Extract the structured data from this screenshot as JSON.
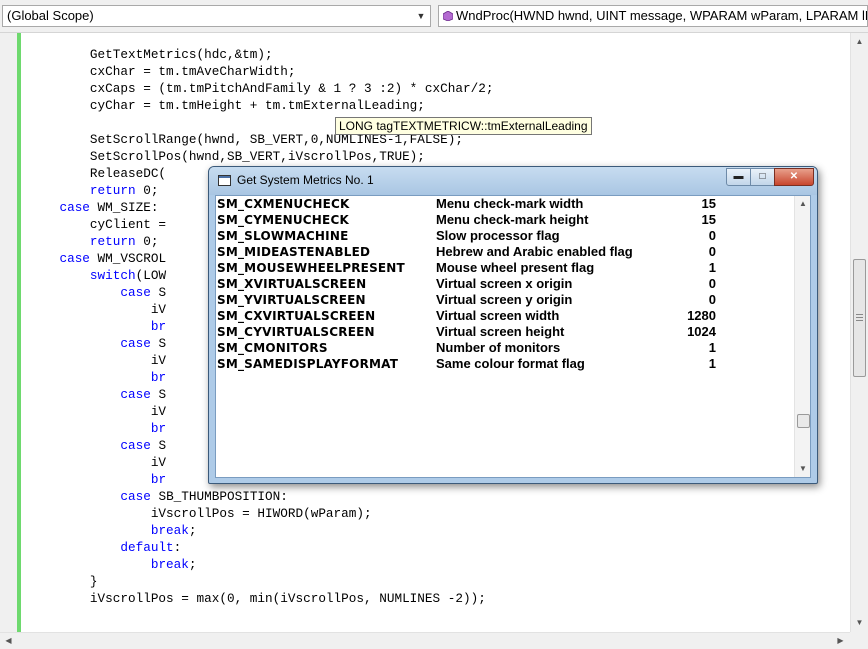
{
  "toolbar": {
    "scope_combo": "(Global Scope)",
    "function_combo": "WndProc(HWND hwnd, UINT message, WPARAM wParam, LPARAM lParam)"
  },
  "code_lines": [
    [
      {
        "t": "        GetTextMetrics(hdc,&tm);"
      }
    ],
    [
      {
        "t": "        cxChar = tm.tmAveCharWidth;"
      }
    ],
    [
      {
        "t": "        cxCaps = (tm.tmPitchAndFamily & 1 ? 3 :2) * cxChar/2;"
      }
    ],
    [
      {
        "t": "        cyChar = tm.tmHeight + tm.tmExternalLeading;"
      }
    ],
    [
      {
        "t": ""
      }
    ],
    [
      {
        "t": "        SetScrollRange(hwnd, SB_VERT,0,NUMLINES-1,FALSE);"
      }
    ],
    [
      {
        "t": "        SetScrollPos(hwnd,SB_VERT,iVscrollPos,TRUE);"
      }
    ],
    [
      {
        "t": "        ReleaseDC("
      }
    ],
    [
      {
        "t": "        "
      },
      {
        "t": "return",
        "k": 1
      },
      {
        "t": " 0;"
      }
    ],
    [
      {
        "t": "    "
      },
      {
        "t": "case",
        "k": 1
      },
      {
        "t": " WM_SIZE:"
      }
    ],
    [
      {
        "t": "        cyClient ="
      }
    ],
    [
      {
        "t": "        "
      },
      {
        "t": "return",
        "k": 1
      },
      {
        "t": " 0;"
      }
    ],
    [
      {
        "t": "    "
      },
      {
        "t": "case",
        "k": 1
      },
      {
        "t": " WM_VSCROL"
      }
    ],
    [
      {
        "t": "        "
      },
      {
        "t": "switch",
        "k": 1
      },
      {
        "t": "(LOW"
      }
    ],
    [
      {
        "t": "            "
      },
      {
        "t": "case",
        "k": 1
      },
      {
        "t": " S"
      }
    ],
    [
      {
        "t": "                iV"
      }
    ],
    [
      {
        "t": "                "
      },
      {
        "t": "br",
        "k": 1
      }
    ],
    [
      {
        "t": "            "
      },
      {
        "t": "case",
        "k": 1
      },
      {
        "t": " S"
      }
    ],
    [
      {
        "t": "                iV"
      }
    ],
    [
      {
        "t": "                "
      },
      {
        "t": "br",
        "k": 1
      }
    ],
    [
      {
        "t": "            "
      },
      {
        "t": "case",
        "k": 1
      },
      {
        "t": " S"
      }
    ],
    [
      {
        "t": "                iV"
      }
    ],
    [
      {
        "t": "                "
      },
      {
        "t": "br",
        "k": 1
      }
    ],
    [
      {
        "t": "            "
      },
      {
        "t": "case",
        "k": 1
      },
      {
        "t": " S"
      }
    ],
    [
      {
        "t": "                iV"
      }
    ],
    [
      {
        "t": "                "
      },
      {
        "t": "br",
        "k": 1
      }
    ],
    [
      {
        "t": "            "
      },
      {
        "t": "case",
        "k": 1
      },
      {
        "t": " SB_THUMBPOSITION:"
      }
    ],
    [
      {
        "t": "                iVscrollPos = HIWORD(wParam);"
      }
    ],
    [
      {
        "t": "                "
      },
      {
        "t": "break",
        "k": 1
      },
      {
        "t": ";"
      }
    ],
    [
      {
        "t": "            "
      },
      {
        "t": "default",
        "k": 1
      },
      {
        "t": ":"
      }
    ],
    [
      {
        "t": "                "
      },
      {
        "t": "break",
        "k": 1
      },
      {
        "t": ";"
      }
    ],
    [
      {
        "t": "        }"
      }
    ],
    [
      {
        "t": "        iVscrollPos = max(0, min(iVscrollPos, NUMLINES -2));"
      }
    ]
  ],
  "tooltip": "LONG tagTEXTMETRICW::tmExternalLeading",
  "window": {
    "title": "Get System Metrics No. 1",
    "rows": [
      {
        "name": "SM_CXMENUCHECK",
        "desc": "Menu check-mark width",
        "value": "15"
      },
      {
        "name": "SM_CYMENUCHECK",
        "desc": "Menu check-mark height",
        "value": "15"
      },
      {
        "name": "SM_SLOWMACHINE",
        "desc": "Slow processor flag",
        "value": "0"
      },
      {
        "name": "SM_MIDEASTENABLED",
        "desc": "Hebrew and Arabic enabled flag",
        "value": "0"
      },
      {
        "name": "SM_MOUSEWHEELPRESENT",
        "desc": "Mouse wheel present flag",
        "value": "1"
      },
      {
        "name": "SM_XVIRTUALSCREEN",
        "desc": "Virtual screen x origin",
        "value": "0"
      },
      {
        "name": "SM_YVIRTUALSCREEN",
        "desc": "Virtual screen y origin",
        "value": "0"
      },
      {
        "name": "SM_CXVIRTUALSCREEN",
        "desc": "Virtual screen width",
        "value": "1280"
      },
      {
        "name": "SM_CYVIRTUALSCREEN",
        "desc": "Virtual screen height",
        "value": "1024"
      },
      {
        "name": "SM_CMONITORS",
        "desc": "Number of monitors",
        "value": "1"
      },
      {
        "name": "SM_SAMEDISPLAYFORMAT",
        "desc": "Same colour format flag",
        "value": "1"
      }
    ]
  },
  "colors": {
    "keyword": "#0000ff",
    "change_bar": "#6ed96e",
    "tooltip_bg": "#ffffe1",
    "window_frame": "#aecbe8",
    "close_button": "#c8462d"
  },
  "icons": {
    "dropdown": "chevron-down-icon",
    "method": "method-icon",
    "window": "app-window-icon",
    "minimize": "minimize-icon",
    "maximize": "maximize-icon",
    "close": "close-icon",
    "scroll_up": "arrow-up-icon",
    "scroll_down": "arrow-down-icon",
    "scroll_left": "arrow-left-icon",
    "scroll_right": "arrow-right-icon"
  }
}
